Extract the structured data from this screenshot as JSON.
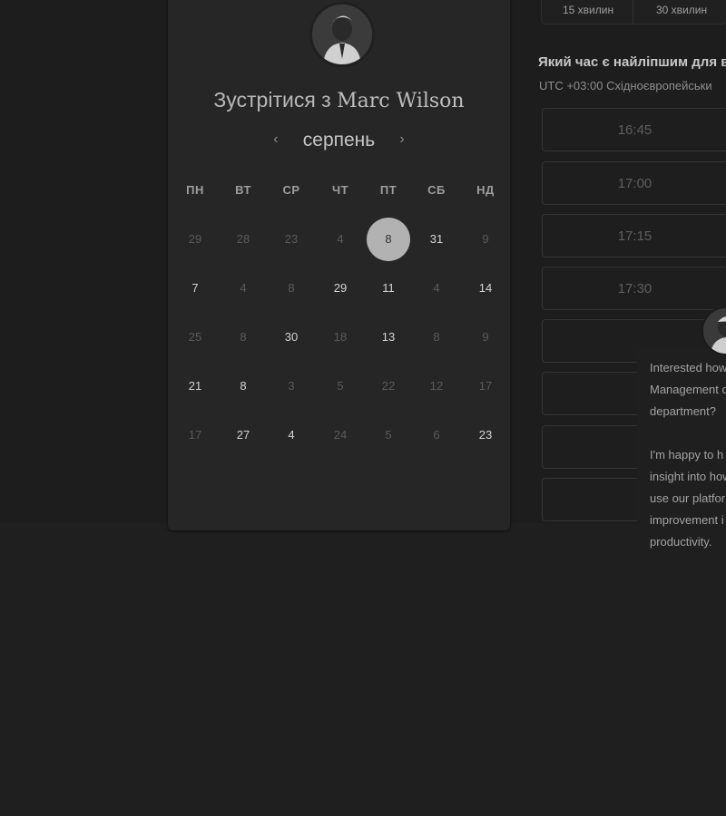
{
  "header": {
    "title_prefix": "Зустрітися з",
    "title_name": "Marc Wilson"
  },
  "calendar": {
    "month": "серпень",
    "weekdays": [
      "ПН",
      "ВТ",
      "СР",
      "ЧТ",
      "ПТ",
      "СБ",
      "НД"
    ],
    "selected": "8",
    "rows": [
      [
        {
          "d": "29",
          "s": "dim"
        },
        {
          "d": "28",
          "s": "dim"
        },
        {
          "d": "23",
          "s": "dim"
        },
        {
          "d": "4",
          "s": "dim"
        },
        {
          "d": "8",
          "s": "sel"
        },
        {
          "d": "31",
          "s": "avail"
        },
        {
          "d": "9",
          "s": "dim"
        }
      ],
      [
        {
          "d": "7",
          "s": "avail"
        },
        {
          "d": "4",
          "s": "dim"
        },
        {
          "d": "8",
          "s": "dim"
        },
        {
          "d": "29",
          "s": "avail"
        },
        {
          "d": "11",
          "s": "avail"
        },
        {
          "d": "4",
          "s": "dim"
        },
        {
          "d": "14",
          "s": "avail"
        }
      ],
      [
        {
          "d": "25",
          "s": "dim"
        },
        {
          "d": "8",
          "s": "dim"
        },
        {
          "d": "30",
          "s": "avail"
        },
        {
          "d": "18",
          "s": "dim"
        },
        {
          "d": "13",
          "s": "avail"
        },
        {
          "d": "8",
          "s": "dim"
        },
        {
          "d": "9",
          "s": "dim"
        }
      ],
      [
        {
          "d": "21",
          "s": "avail"
        },
        {
          "d": "8",
          "s": "avail"
        },
        {
          "d": "3",
          "s": "dim"
        },
        {
          "d": "5",
          "s": "dim"
        },
        {
          "d": "22",
          "s": "dim"
        },
        {
          "d": "12",
          "s": "dim"
        },
        {
          "d": "17",
          "s": "dim"
        }
      ],
      [
        {
          "d": "17",
          "s": "dim"
        },
        {
          "d": "27",
          "s": "avail"
        },
        {
          "d": "4",
          "s": "avail"
        },
        {
          "d": "24",
          "s": "dim"
        },
        {
          "d": "5",
          "s": "dim"
        },
        {
          "d": "6",
          "s": "dim"
        },
        {
          "d": "23",
          "s": "avail"
        }
      ]
    ]
  },
  "durations": [
    "15 хвилин",
    "30 хвилин"
  ],
  "time_panel": {
    "question": "Який час є найліпшим для в",
    "timezone": "UTC +03:00 Східноєвропейськи",
    "slots": [
      "16:45",
      "17:00",
      "17:15",
      "17:30",
      "",
      "",
      "",
      ""
    ]
  },
  "chat": {
    "lines": [
      "Interested how",
      "Management c",
      "department?",
      "",
      "I'm happy to h",
      "insight into how",
      "use our platfor",
      "improvement i",
      "productivity."
    ]
  },
  "icons": {
    "prev": "chevron-left-icon",
    "next": "chevron-right-icon"
  }
}
